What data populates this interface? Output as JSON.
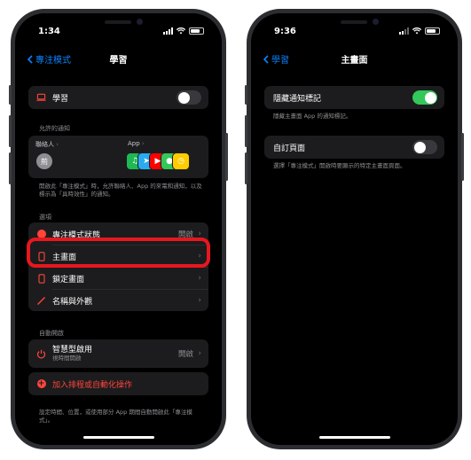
{
  "left_phone": {
    "status": {
      "time": "1:34"
    },
    "nav": {
      "back_label": "專注模式",
      "title": "學習"
    },
    "focus_row": {
      "label": "學習",
      "toggle_on": false
    },
    "allowed_notifications": {
      "section_label": "允許的通知",
      "people_label": "聯絡人",
      "apps_label": "App",
      "avatar_initial": "荊",
      "app_icons": [
        {
          "name": "spotify-icon",
          "color": "#1db954",
          "glyph": "♫"
        },
        {
          "name": "telegram-icon",
          "color": "#2aabee",
          "glyph": "➤"
        },
        {
          "name": "youtube-icon",
          "color": "#ff0000",
          "glyph": "▶"
        },
        {
          "name": "messages-icon",
          "color": "#34c759",
          "glyph": "●"
        },
        {
          "name": "clock-icon",
          "color": "#ffcc00",
          "glyph": "◷"
        }
      ],
      "note": "開啟此「專注模式」時，允許聯絡人、App 的來電和通知，以及標示為「具時效性」的通知。"
    },
    "options": {
      "section_label": "選項",
      "items": [
        {
          "label": "專注模式狀態",
          "value": "開啟",
          "icon": "moon-icon"
        },
        {
          "label": "主畫面",
          "value": "",
          "icon": "home-screen-icon"
        },
        {
          "label": "鎖定畫面",
          "value": "",
          "icon": "lock-screen-icon"
        },
        {
          "label": "名稱與外觀",
          "value": "",
          "icon": "pencil-icon"
        }
      ]
    },
    "auto": {
      "section_label": "自動開啟",
      "smart_label": "智慧型啟用",
      "smart_sub": "視時間開啟",
      "smart_value": "開啟",
      "add_label": "加入排程或自動化操作",
      "note": "設定時間、位置，或使用部分 App 期間自動開啟此「專注模式」。"
    }
  },
  "right_phone": {
    "status": {
      "time": "9:36"
    },
    "nav": {
      "back_label": "學習",
      "title": "主畫面"
    },
    "hide_badges": {
      "label": "隱藏通知標記",
      "toggle_on": true,
      "note": "隱藏主畫面 App 的通知標記。"
    },
    "custom_pages": {
      "label": "自訂頁面",
      "toggle_on": false,
      "note": "選擇「專注模式」開啟時要顯示的特定主畫面頁面。"
    }
  },
  "colors": {
    "accent": "#0a84ff",
    "highlight": "#e8171f",
    "toggle_on": "#34c759",
    "destructive": "#ff453a"
  }
}
